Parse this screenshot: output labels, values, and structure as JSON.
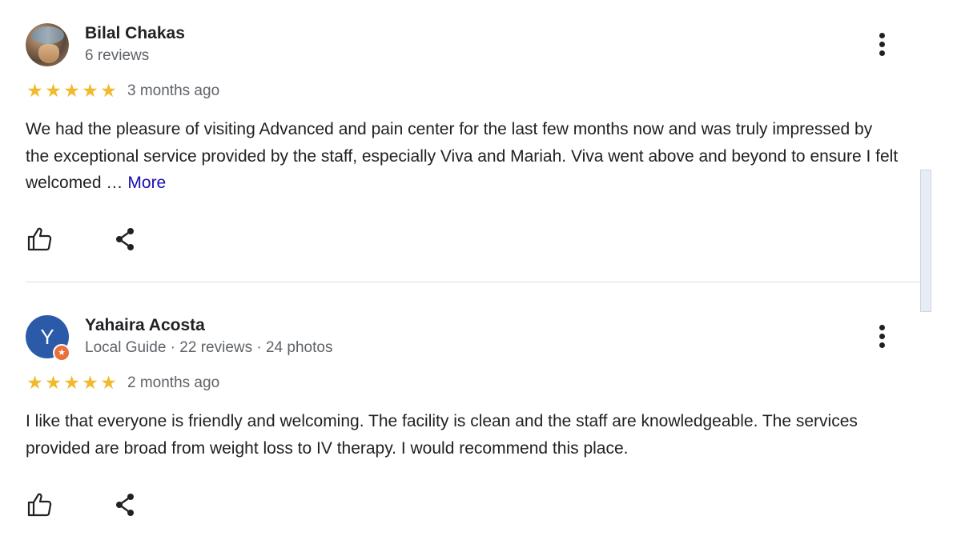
{
  "reviews": [
    {
      "author": "Bilal Chakas",
      "meta": "6 reviews",
      "avatar_type": "photo",
      "rating": 5,
      "stars": "★★★★★",
      "date": "3 months ago",
      "text": "We had the pleasure of visiting Advanced and pain center for the last few months now and was truly impressed by the exceptional service provided by the staff, especially Viva and Mariah. Viva went above and beyond to ensure I felt welcomed …",
      "more_label": "More"
    },
    {
      "author": "Yahaira Acosta",
      "meta": "Local Guide · 22 reviews · 24 photos",
      "avatar_type": "letter",
      "avatar_letter": "Y",
      "avatar_color": "#2b5ba8",
      "badge_color": "#e8703a",
      "badge_icon": "★",
      "rating": 5,
      "stars": "★★★★★",
      "date": "2 months ago",
      "text": "I like that everyone is friendly and welcoming. The facility is clean and the staff are knowledgeable. The services provided are broad from weight loss to IV therapy. I would recommend this place."
    }
  ],
  "icons": {
    "like": "thumbs-up-icon",
    "share": "share-icon",
    "more": "more-vert-icon"
  },
  "colors": {
    "star": "#f2b92d",
    "link": "#1a0dab",
    "meta_text": "#5f6368",
    "divider": "#dadce0"
  }
}
